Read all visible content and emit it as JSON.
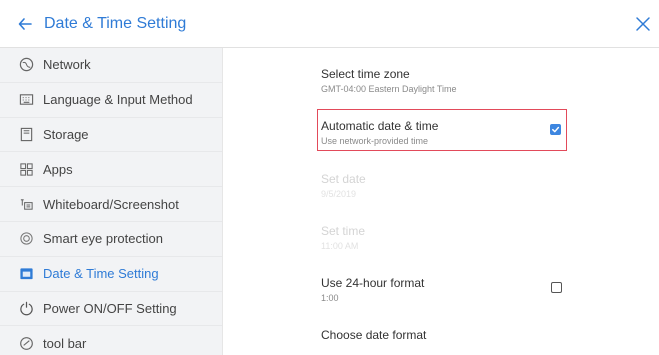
{
  "header": {
    "title": "Date & Time Setting"
  },
  "sidebar": {
    "items": [
      {
        "label": "Network",
        "icon": "globe-icon"
      },
      {
        "label": "Language & Input Method",
        "icon": "keyboard-icon"
      },
      {
        "label": "Storage",
        "icon": "storage-icon"
      },
      {
        "label": "Apps",
        "icon": "apps-icon"
      },
      {
        "label": "Whiteboard/Screenshot",
        "icon": "whiteboard-icon"
      },
      {
        "label": "Smart eye protection",
        "icon": "eye-icon"
      },
      {
        "label": "Date & Time Setting",
        "icon": "calendar-icon",
        "active": true
      },
      {
        "label": "Power ON/OFF Setting",
        "icon": "power-icon"
      },
      {
        "label": "tool bar",
        "icon": "toolbar-icon"
      }
    ]
  },
  "main": {
    "time_zone": {
      "title": "Select time zone",
      "subtitle": "GMT-04:00 Eastern Daylight Time"
    },
    "auto_time": {
      "title": "Automatic date & time",
      "subtitle": "Use network-provided time",
      "checked": true
    },
    "set_date": {
      "title": "Set date",
      "subtitle": "9/5/2019",
      "disabled": true
    },
    "set_time": {
      "title": "Set time",
      "subtitle": "11:00 AM",
      "disabled": true
    },
    "hour_format": {
      "title": "Use 24-hour format",
      "subtitle": "1:00",
      "checked": false
    },
    "date_format": {
      "title": "Choose date format"
    }
  },
  "colors": {
    "accent": "#2f7bd6",
    "highlight": "#e24a5a",
    "sidebar_bg": "#f2f3f5"
  }
}
